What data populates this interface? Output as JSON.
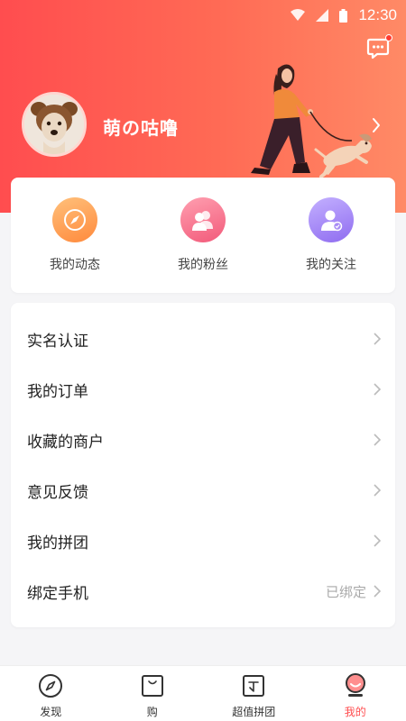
{
  "status_bar": {
    "time": "12:30"
  },
  "profile": {
    "username": "萌の咕噜"
  },
  "quick_actions": [
    {
      "label": "我的动态",
      "icon": "compass-icon"
    },
    {
      "label": "我的粉丝",
      "icon": "fans-icon"
    },
    {
      "label": "我的关注",
      "icon": "follow-icon"
    }
  ],
  "menu": [
    {
      "label": "实名认证",
      "value": ""
    },
    {
      "label": "我的订单",
      "value": ""
    },
    {
      "label": "收藏的商户",
      "value": ""
    },
    {
      "label": "意见反馈",
      "value": ""
    },
    {
      "label": "我的拼团",
      "value": ""
    },
    {
      "label": "绑定手机",
      "value": "已绑定"
    }
  ],
  "tabbar": [
    {
      "label": "发现",
      "icon": "compass-icon",
      "active": false
    },
    {
      "label": "购",
      "icon": "bag-icon",
      "active": false
    },
    {
      "label": "超值拼团",
      "icon": "group-buy-icon",
      "active": false
    },
    {
      "label": "我的",
      "icon": "profile-icon",
      "active": true
    }
  ],
  "colors": {
    "accent": "#ff4d4f",
    "header_gradient_start": "#ff4d4f",
    "header_gradient_end": "#ff8a66",
    "orange": "#ff8a3d",
    "pink": "#f25a7a",
    "purple": "#8f6cf0"
  }
}
